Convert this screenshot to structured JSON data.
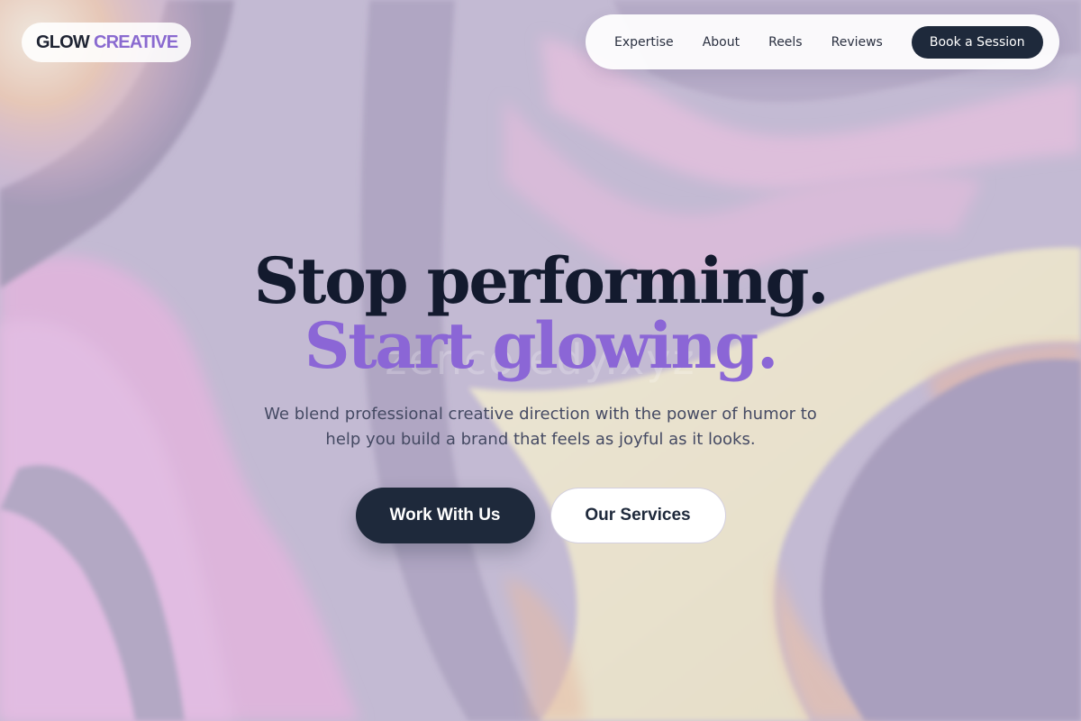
{
  "brand": {
    "word1": "GLOW",
    "word2": "CREATIVE"
  },
  "nav": {
    "items": [
      "Expertise",
      "About",
      "Reels",
      "Reviews"
    ],
    "cta": "Book a Session"
  },
  "hero": {
    "line1": "Stop performing.",
    "line2": "Start glowing.",
    "watermark": "zencoiedy.xyz",
    "subtitle_line1": "We blend professional creative direction with the power of humor to",
    "subtitle_line2": "help you build a brand that feels as joyful as it looks.",
    "primary_button": "Work With Us",
    "secondary_button": "Our Services"
  },
  "colors": {
    "dark": "#1e293b",
    "accent": "#8b66d6",
    "heading": "#131a2e",
    "body_text": "#454a63"
  }
}
